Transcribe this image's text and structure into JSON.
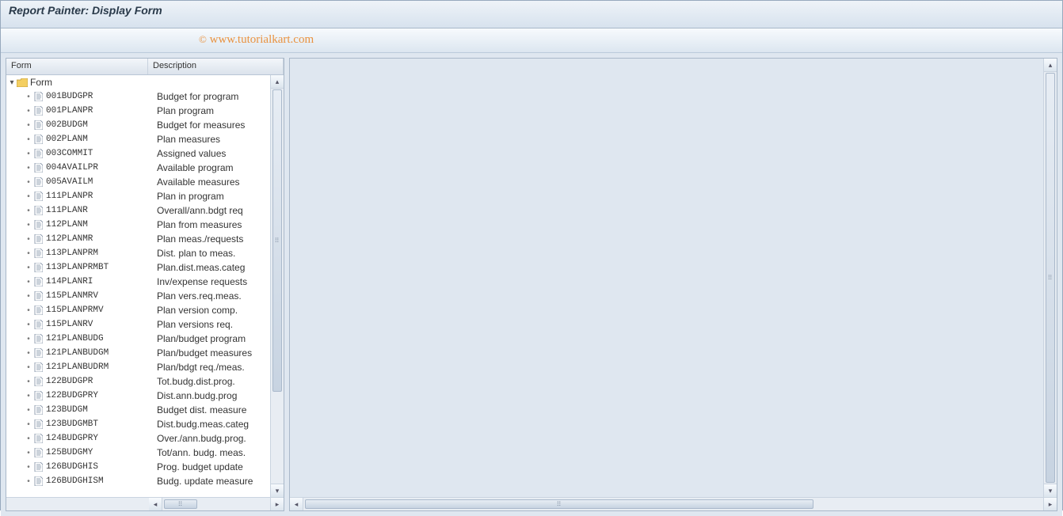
{
  "title": "Report Painter: Display Form",
  "watermark": {
    "copy": "©",
    "text": "www.tutorialkart.com"
  },
  "columns": {
    "form": "Form",
    "description": "Description"
  },
  "root": {
    "label": "Form"
  },
  "items": [
    {
      "form": "001BUDGPR",
      "desc": "Budget for program"
    },
    {
      "form": "001PLANPR",
      "desc": "Plan program"
    },
    {
      "form": "002BUDGM",
      "desc": "Budget for measures"
    },
    {
      "form": "002PLANM",
      "desc": "Plan measures"
    },
    {
      "form": "003COMMIT",
      "desc": "Assigned values"
    },
    {
      "form": "004AVAILPR",
      "desc": "Available program"
    },
    {
      "form": "005AVAILM",
      "desc": "Available measures"
    },
    {
      "form": "111PLANPR",
      "desc": "Plan in program"
    },
    {
      "form": "111PLANR",
      "desc": "Overall/ann.bdgt req"
    },
    {
      "form": "112PLANM",
      "desc": "Plan from measures"
    },
    {
      "form": "112PLANMR",
      "desc": "Plan meas./requests"
    },
    {
      "form": "113PLANPRM",
      "desc": "Dist. plan to meas."
    },
    {
      "form": "113PLANPRMBT",
      "desc": "Plan.dist.meas.categ"
    },
    {
      "form": "114PLANRI",
      "desc": "Inv/expense requests"
    },
    {
      "form": "115PLANMRV",
      "desc": "Plan vers.req.meas."
    },
    {
      "form": "115PLANPRMV",
      "desc": "Plan version comp."
    },
    {
      "form": "115PLANRV",
      "desc": "Plan versions req."
    },
    {
      "form": "121PLANBUDG",
      "desc": "Plan/budget program"
    },
    {
      "form": "121PLANBUDGM",
      "desc": "Plan/budget measures"
    },
    {
      "form": "121PLANBUDRM",
      "desc": "Plan/bdgt req./meas."
    },
    {
      "form": "122BUDGPR",
      "desc": "Tot.budg.dist.prog."
    },
    {
      "form": "122BUDGPRY",
      "desc": "Dist.ann.budg.prog"
    },
    {
      "form": "123BUDGM",
      "desc": "Budget dist. measure"
    },
    {
      "form": "123BUDGMBT",
      "desc": "Dist.budg.meas.categ"
    },
    {
      "form": "124BUDGPRY",
      "desc": "Over./ann.budg.prog."
    },
    {
      "form": "125BUDGMY",
      "desc": "Tot/ann. budg. meas."
    },
    {
      "form": "126BUDGHIS",
      "desc": "Prog. budget update"
    },
    {
      "form": "126BUDGHISM",
      "desc": "Budg. update measure"
    }
  ]
}
